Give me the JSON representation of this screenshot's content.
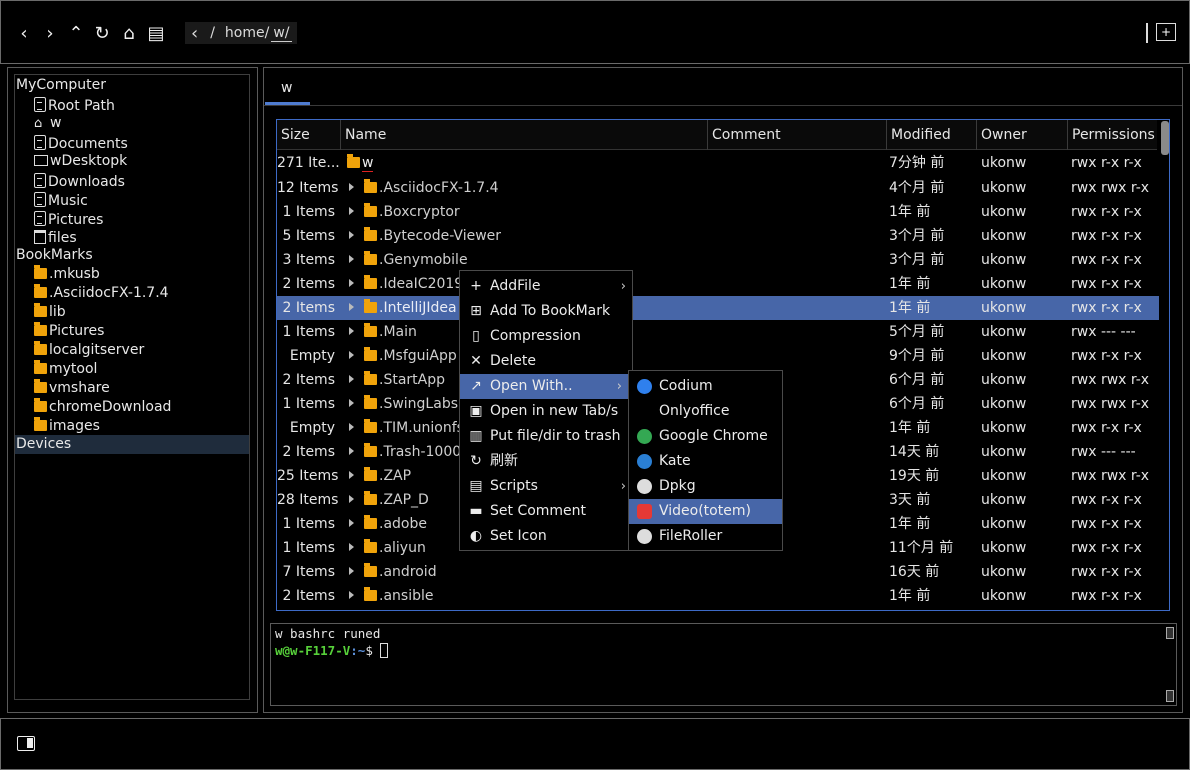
{
  "toolbar": {
    "back": "‹",
    "forward": "›",
    "up": "⌃",
    "refresh": "↻",
    "home": "⌂",
    "drive": "▤",
    "path_back": "‹",
    "path_segments": [
      "/",
      "home/",
      "w/"
    ]
  },
  "sidebar": {
    "sections": [
      {
        "label": "MyComputer",
        "items": [
          {
            "icon": "document-icon",
            "label": "Root Path"
          },
          {
            "icon": "home-icon",
            "label": "w"
          },
          {
            "icon": "document-icon",
            "label": "Documents"
          },
          {
            "icon": "folder-outline-icon",
            "label": "wDesktopk"
          },
          {
            "icon": "document-icon",
            "label": "Downloads"
          },
          {
            "icon": "document-icon",
            "label": "Music"
          },
          {
            "icon": "document-icon",
            "label": "Pictures"
          },
          {
            "icon": "trash-icon",
            "label": "files"
          }
        ]
      },
      {
        "label": "BookMarks",
        "items": [
          {
            "icon": "folder-icon",
            "label": ".mkusb"
          },
          {
            "icon": "folder-icon",
            "label": ".AsciidocFX-1.7.4"
          },
          {
            "icon": "folder-icon",
            "label": "lib"
          },
          {
            "icon": "folder-icon",
            "label": "Pictures"
          },
          {
            "icon": "folder-icon",
            "label": "localgitserver"
          },
          {
            "icon": "folder-icon",
            "label": "mytool"
          },
          {
            "icon": "folder-icon",
            "label": "vmshare"
          },
          {
            "icon": "folder-icon",
            "label": "chromeDownload"
          },
          {
            "icon": "folder-icon",
            "label": "images"
          }
        ]
      },
      {
        "label": "Devices",
        "items": []
      }
    ]
  },
  "tab": {
    "label": "w"
  },
  "table": {
    "headers": [
      "Size",
      "Name",
      "Comment",
      "Modified",
      "Owner",
      "Permissions"
    ],
    "rows": [
      {
        "size": "271 Ite...",
        "name": "w",
        "mod": "7分钟 前",
        "owner": "ukonw",
        "perm": "rwx r-x r-x",
        "root": true
      },
      {
        "size": "12 Items",
        "name": ".AsciidocFX-1.7.4",
        "mod": "4个月 前",
        "owner": "ukonw",
        "perm": "rwx rwx r-x"
      },
      {
        "size": "1 Items",
        "name": ".Boxcryptor",
        "mod": "1年 前",
        "owner": "ukonw",
        "perm": "rwx r-x r-x"
      },
      {
        "size": "5 Items",
        "name": ".Bytecode-Viewer",
        "mod": "3个月 前",
        "owner": "ukonw",
        "perm": "rwx r-x r-x"
      },
      {
        "size": "3 Items",
        "name": ".Genymobile",
        "mod": "3个月 前",
        "owner": "ukonw",
        "perm": "rwx r-x r-x"
      },
      {
        "size": "2 Items",
        "name": ".IdeaIC2019",
        "mod": "1年 前",
        "owner": "ukonw",
        "perm": "rwx r-x r-x"
      },
      {
        "size": "2 Items",
        "name": ".IntelliJIdea",
        "mod": "1年 前",
        "owner": "ukonw",
        "perm": "rwx r-x r-x",
        "selected": true
      },
      {
        "size": "1 Items",
        "name": ".Main",
        "mod": "5个月 前",
        "owner": "ukonw",
        "perm": "rwx --- ---"
      },
      {
        "size": "Empty",
        "name": ".MsfguiApp",
        "mod": "9个月 前",
        "owner": "ukonw",
        "perm": "rwx r-x r-x"
      },
      {
        "size": "2 Items",
        "name": ".StartApp",
        "mod": "6个月 前",
        "owner": "ukonw",
        "perm": "rwx rwx r-x"
      },
      {
        "size": "1 Items",
        "name": ".SwingLabsI",
        "mod": "6个月 前",
        "owner": "ukonw",
        "perm": "rwx rwx r-x"
      },
      {
        "size": "Empty",
        "name": ".TIM.unionfs",
        "mod": "1年 前",
        "owner": "ukonw",
        "perm": "rwx r-x r-x"
      },
      {
        "size": "2 Items",
        "name": ".Trash-1000",
        "mod": "14天 前",
        "owner": "ukonw",
        "perm": "rwx --- ---"
      },
      {
        "size": "25 Items",
        "name": ".ZAP",
        "mod": "19天 前",
        "owner": "ukonw",
        "perm": "rwx rwx r-x"
      },
      {
        "size": "28 Items",
        "name": ".ZAP_D",
        "mod": "3天 前",
        "owner": "ukonw",
        "perm": "rwx r-x r-x"
      },
      {
        "size": "1 Items",
        "name": ".adobe",
        "mod": "1年 前",
        "owner": "ukonw",
        "perm": "rwx r-x r-x"
      },
      {
        "size": "1 Items",
        "name": ".aliyun",
        "mod": "11个月 前",
        "owner": "ukonw",
        "perm": "rwx r-x r-x"
      },
      {
        "size": "7 Items",
        "name": ".android",
        "mod": "16天 前",
        "owner": "ukonw",
        "perm": "rwx r-x r-x"
      },
      {
        "size": "2 Items",
        "name": ".ansible",
        "mod": "1年 前",
        "owner": "ukonw",
        "perm": "rwx r-x r-x"
      }
    ]
  },
  "context_menu": [
    {
      "icon": "plus-icon",
      "glyph": "+",
      "label": "AddFile",
      "submenu": true
    },
    {
      "icon": "bookmark-add-icon",
      "glyph": "⊞",
      "label": "Add To BookMark"
    },
    {
      "icon": "zip-icon",
      "glyph": "▯",
      "label": "Compression"
    },
    {
      "icon": "delete-icon",
      "glyph": "✕",
      "label": "Delete"
    },
    {
      "icon": "open-with-icon",
      "glyph": "↗",
      "label": "Open With..",
      "submenu": true,
      "selected": true
    },
    {
      "icon": "new-tab-icon",
      "glyph": "▣",
      "label": "Open in new Tab/s"
    },
    {
      "icon": "trash-icon",
      "glyph": "▥",
      "label": "Put file/dir to trash"
    },
    {
      "icon": "refresh-icon",
      "glyph": "↻",
      "label": "刷新"
    },
    {
      "icon": "scripts-icon",
      "glyph": "▤",
      "label": "Scripts",
      "submenu": true
    },
    {
      "icon": "comment-icon",
      "glyph": "▬",
      "label": "Set Comment"
    },
    {
      "icon": "set-icon-icon",
      "glyph": "◐",
      "label": "Set Icon"
    }
  ],
  "open_with_menu": [
    {
      "icon": "codium-icon",
      "label": "Codium",
      "color": "#2f80ed"
    },
    {
      "icon": "onlyoffice-icon",
      "label": "Onlyoffice",
      "color": ""
    },
    {
      "icon": "chrome-icon",
      "label": "Google Chrome",
      "color": "#34a853"
    },
    {
      "icon": "kate-icon",
      "label": "Kate",
      "color": "#2a7fd4"
    },
    {
      "icon": "dpkg-icon",
      "label": "Dpkg",
      "color": "#dddddd"
    },
    {
      "icon": "video-icon",
      "label": "Video(totem)",
      "color": "#e53935",
      "selected": true
    },
    {
      "icon": "fileroller-icon",
      "label": "FileRoller",
      "color": "#dddddd"
    }
  ],
  "terminal": {
    "line1": "w bashrc runed",
    "prompt_user": "w@w-F117-V",
    "prompt_path": ":~",
    "prompt_sym": "$ "
  },
  "colors": {
    "selection": "#4766a8",
    "folder": "#f0a30a",
    "accent": "#4e7bd0",
    "term_green": "#57d13a"
  }
}
